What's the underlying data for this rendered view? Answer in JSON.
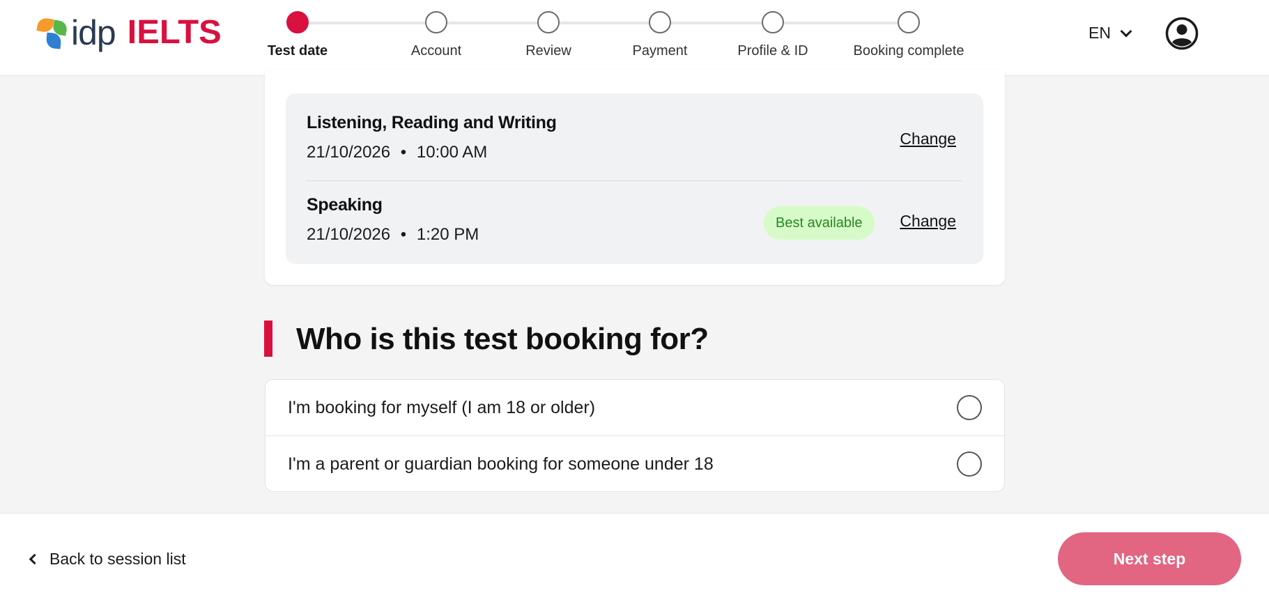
{
  "brand": {
    "logo_text": "idp",
    "product": "IELTS",
    "accent_color": "#d8113f"
  },
  "stepper": {
    "current_step": "Test date",
    "steps": [
      {
        "label": "Test date",
        "state": "active"
      },
      {
        "label": "Account",
        "state": "upcoming"
      },
      {
        "label": "Review",
        "state": "upcoming"
      },
      {
        "label": "Payment",
        "state": "upcoming"
      },
      {
        "label": "Profile & ID",
        "state": "upcoming"
      },
      {
        "label": "Booking complete",
        "state": "upcoming"
      }
    ]
  },
  "header": {
    "language": "EN",
    "language_icon": "chevron-down-icon",
    "account_icon": "user-account-icon"
  },
  "sessions": [
    {
      "title": "Listening, Reading and Writing",
      "date": "21/10/2026",
      "separator": "•",
      "time": "10:00 AM",
      "change_label": "Change"
    },
    {
      "title": "Speaking",
      "date": "21/10/2026",
      "separator": "•",
      "time": "1:20 PM",
      "badge": "Best available",
      "badge_color": "#26871f",
      "change_label": "Change"
    }
  ],
  "question": {
    "title": "Who is this test booking for?",
    "options": [
      {
        "label": "I'm booking for myself (I am 18 or older)",
        "selected": false
      },
      {
        "label": "I'm a parent or guardian booking for someone under 18",
        "selected": false
      }
    ]
  },
  "footer": {
    "back_label": "Back to session list",
    "next_label": "Next step",
    "next_color": "#e26581"
  }
}
